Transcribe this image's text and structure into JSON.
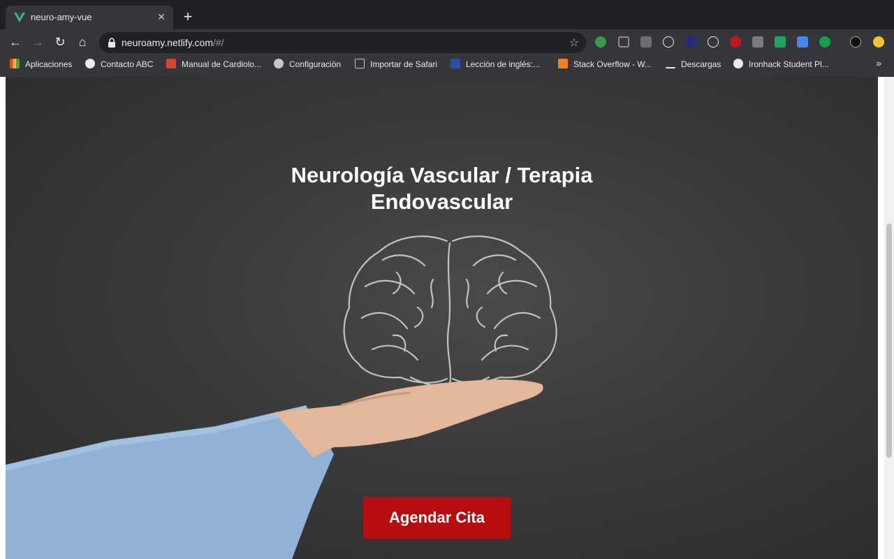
{
  "browser": {
    "tab": {
      "title": "neuro-amy-vue",
      "close_label": "✕"
    },
    "newtab_label": "+",
    "url_host": "neuroamy.netlify.com",
    "url_path": "/#/",
    "bookmarks": [
      {
        "label": "Aplicaciones",
        "icon": "apps-grid-icon"
      },
      {
        "label": "Contacto ABC",
        "icon": "globe-icon"
      },
      {
        "label": "Manual de Cardiolo...",
        "icon": "manual-icon"
      },
      {
        "label": "Configuración",
        "icon": "gear-icon"
      },
      {
        "label": "Importar de Safari",
        "icon": "folder-icon"
      },
      {
        "label": "Lección de inglés:...",
        "icon": "lesson-icon"
      },
      {
        "label": "Stack Overflow - W...",
        "icon": "stackoverflow-icon"
      },
      {
        "label": "Descargas",
        "icon": "download-icon"
      },
      {
        "label": "Ironhack Student Pl...",
        "icon": "globe-icon"
      }
    ],
    "bookmarks_more": "»"
  },
  "hero": {
    "title_line1": "Neurología Vascular / Terapia",
    "title_line2": "Endovascular",
    "cta_label": "Agendar Cita"
  },
  "colors": {
    "cta": "#b50d10",
    "chalkboard": "#3a3a3a",
    "chrome": "#35363a"
  }
}
